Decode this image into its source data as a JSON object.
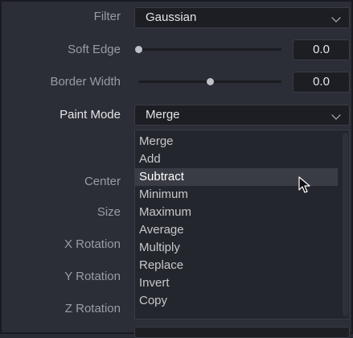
{
  "filter": {
    "label": "Filter",
    "value": "Gaussian"
  },
  "soft_edge": {
    "label": "Soft Edge",
    "value": "0.0",
    "slider_fraction": 0.0
  },
  "border_width": {
    "label": "Border Width",
    "value": "0.0",
    "slider_fraction": 0.5
  },
  "paint_mode": {
    "label": "Paint Mode",
    "value": "Merge",
    "options": [
      "Merge",
      "Add",
      "Subtract",
      "Minimum",
      "Maximum",
      "Average",
      "Multiply",
      "Replace",
      "Invert",
      "Copy"
    ],
    "hovered_option": "Subtract"
  },
  "hidden_labels": {
    "center": "Center",
    "size": "Size",
    "x_rotation": "X Rotation",
    "y_rotation": "Y Rotation",
    "z_rotation": "Z Rotation"
  },
  "icons": {
    "dropdown": "chevron-down-icon",
    "cursor": "mouse-pointer-icon"
  }
}
